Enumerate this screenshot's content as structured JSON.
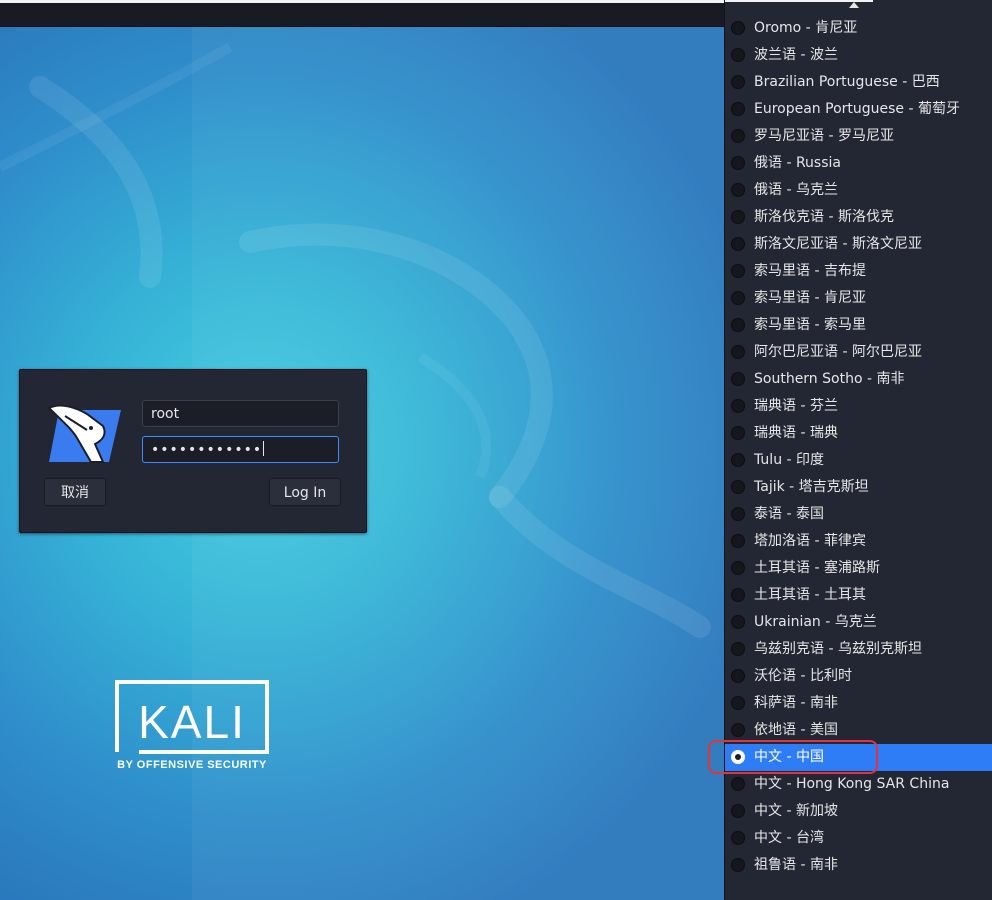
{
  "login": {
    "username": "root",
    "password_mask": "••••••••••••",
    "cancel_label": "取消",
    "login_label": "Log In"
  },
  "brand": {
    "logo_text": "KALI",
    "tagline": "BY OFFENSIVE SECURITY"
  },
  "languages": {
    "selected_index": 27,
    "items": [
      "Oromo - 肯尼亚",
      "波兰语 - 波兰",
      "Brazilian Portuguese - 巴西",
      "European Portuguese - 葡萄牙",
      "罗马尼亚语 - 罗马尼亚",
      "俄语 - Russia",
      "俄语 - 乌克兰",
      "斯洛伐克语 - 斯洛伐克",
      "斯洛文尼亚语 - 斯洛文尼亚",
      "索马里语 - 吉布提",
      "索马里语 - 肯尼亚",
      "索马里语 - 索马里",
      "阿尔巴尼亚语 - 阿尔巴尼亚",
      "Southern Sotho - 南非",
      "瑞典语 - 芬兰",
      "瑞典语 - 瑞典",
      "Tulu - 印度",
      "Tajik - 塔吉克斯坦",
      "泰语 - 泰国",
      "塔加洛语 - 菲律宾",
      "土耳其语 - 塞浦路斯",
      "土耳其语 - 土耳其",
      "Ukrainian - 乌克兰",
      "乌兹别克语 - 乌兹别克斯坦",
      "沃伦语 - 比利时",
      "科萨语 - 南非",
      "依地语 - 美国",
      "中文 - 中国",
      "中文 - Hong Kong SAR China",
      "中文 - 新加坡",
      "中文 - 台湾",
      "祖鲁语 - 南非"
    ]
  },
  "colors": {
    "selection": "#2f7df6",
    "annotation": "#e0353f",
    "panel": "#232733"
  }
}
